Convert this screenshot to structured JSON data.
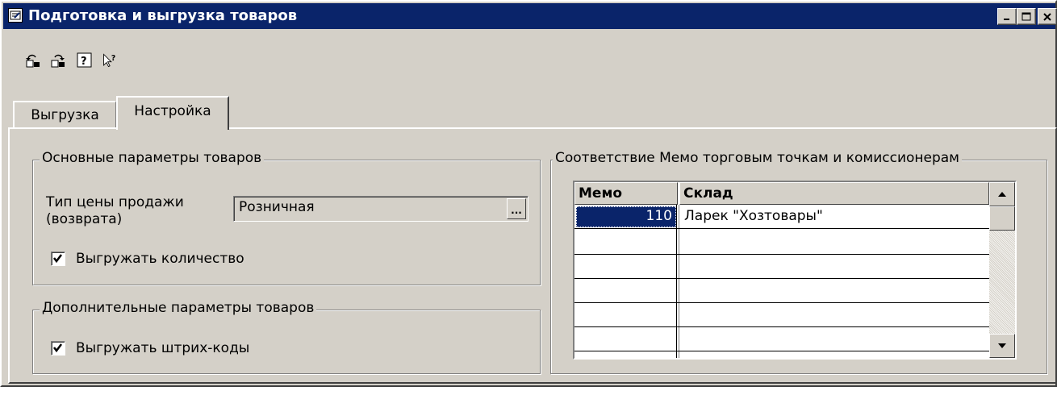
{
  "window": {
    "title": "Подготовка и выгрузка товаров",
    "title_icon": "form-icon",
    "controls": [
      "minimize-icon",
      "maximize-icon",
      "close-icon"
    ]
  },
  "toolbar": {
    "icons": [
      "undo-icon",
      "redo-icon",
      "help-icon",
      "context-help-icon"
    ]
  },
  "tabs": [
    {
      "label": "Выгрузка",
      "active": false
    },
    {
      "label": "Настройка",
      "active": true
    }
  ],
  "main_params": {
    "legend": "Основные параметры товаров",
    "price_type_label_line1": "Тип цены продажи",
    "price_type_label_line2": "(возврата)",
    "price_type_value": "Розничная",
    "select_button_label": "...",
    "export_quantity_label": "Выгружать количество",
    "export_quantity_checked": true
  },
  "extra_params": {
    "legend": "Дополнительные параметры товаров",
    "export_barcodes_label": "Выгружать штрих-коды",
    "export_barcodes_checked": true
  },
  "memo_mapping": {
    "legend": "Соответствие Мемо торговым точкам и комиссионерам",
    "columns": [
      "Мемо",
      "Склад"
    ],
    "rows": [
      {
        "memo": "110",
        "warehouse": "Ларек \"Хозтовары\""
      }
    ]
  },
  "colors": {
    "title_bar": "#0a246a",
    "face": "#d4d0c8",
    "selection": "#0a246a"
  }
}
